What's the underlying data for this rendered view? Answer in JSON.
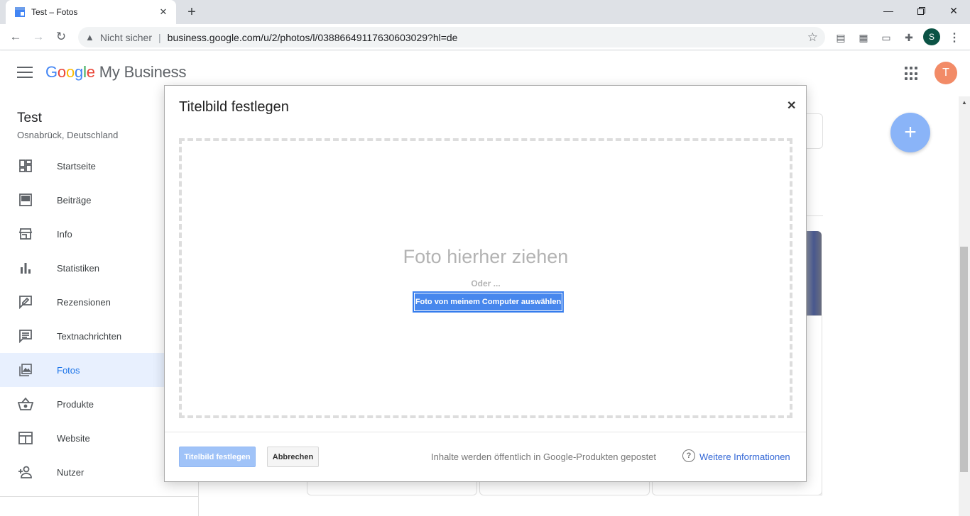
{
  "browser": {
    "tab_title": "Test – Fotos",
    "security_label": "Nicht sicher",
    "url": "business.google.com/u/2/photos/l/03886649117630603029?hl=de",
    "profile_initial": "S"
  },
  "app": {
    "logo_google": [
      "G",
      "o",
      "o",
      "g",
      "l",
      "e"
    ],
    "logo_rest": "My Business",
    "user_initial": "T"
  },
  "sidebar": {
    "business_name": "Test",
    "business_address": "Osnabrück, Deutschland",
    "items": [
      {
        "label": "Startseite",
        "icon": "dashboard-icon"
      },
      {
        "label": "Beiträge",
        "icon": "posts-icon"
      },
      {
        "label": "Info",
        "icon": "storefront-icon"
      },
      {
        "label": "Statistiken",
        "icon": "bar-chart-icon"
      },
      {
        "label": "Rezensionen",
        "icon": "review-icon"
      },
      {
        "label": "Textnachrichten",
        "icon": "message-icon"
      },
      {
        "label": "Fotos",
        "icon": "photo-icon",
        "active": true
      },
      {
        "label": "Produkte",
        "icon": "basket-icon"
      },
      {
        "label": "Website",
        "icon": "website-icon"
      },
      {
        "label": "Nutzer",
        "icon": "add-user-icon"
      }
    ]
  },
  "dialog": {
    "title": "Titelbild festlegen",
    "drop_text": "Foto hierher ziehen",
    "or_text": "Oder ...",
    "select_button": "Foto von meinem Computer auswählen",
    "confirm_button": "Titelbild festlegen",
    "cancel_button": "Abbrechen",
    "public_note": "Inhalte werden öffentlich in Google-Produkten gepostet",
    "more_info": "Weitere Informationen"
  },
  "colors": {
    "accent": "#4787ed",
    "active_nav_bg": "#e8f0fe",
    "fab": "#8ab4f8",
    "avatar": "#f28b67"
  }
}
